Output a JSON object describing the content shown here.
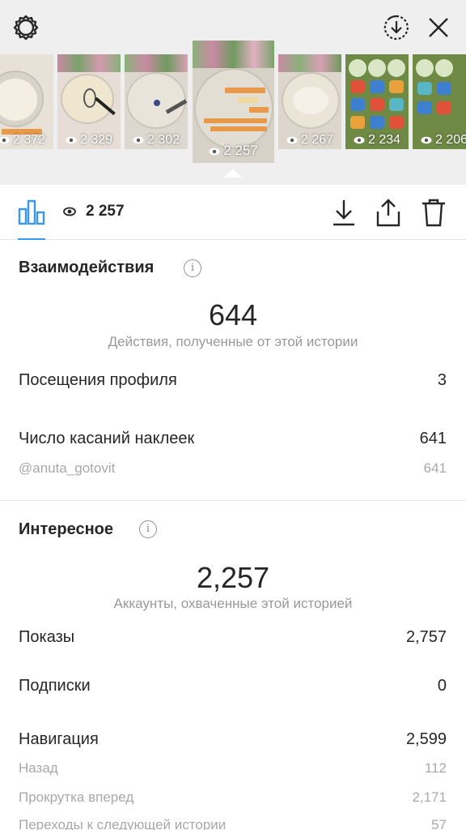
{
  "thumbnails": [
    {
      "views": "2 372"
    },
    {
      "views": "2 329"
    },
    {
      "views": "2 302"
    },
    {
      "views": "2 257"
    },
    {
      "views": "2 267"
    },
    {
      "views": "2 234"
    },
    {
      "views": "2 206"
    }
  ],
  "toolbar": {
    "views": "2 257",
    "icons": [
      "bar-chart-icon",
      "eye-icon",
      "download-icon",
      "share-icon",
      "trash-icon"
    ]
  },
  "top_icons": [
    "gear-icon",
    "download-circle-icon",
    "close-icon"
  ],
  "interactions": {
    "title": "Взаимодействия",
    "total": "644",
    "caption": "Действия, полученные от этой истории",
    "rows": [
      {
        "label": "Посещения профиля",
        "value": "3"
      },
      {
        "label": "Число касаний наклеек",
        "value": "641"
      }
    ],
    "sub_rows": [
      {
        "label": "@anuta_gotovit",
        "value": "641"
      }
    ]
  },
  "discovery": {
    "title": "Интересное",
    "total": "2,257",
    "caption": "Аккаунты, охваченные этой историей",
    "rows": [
      {
        "label": "Показы",
        "value": "2,757"
      },
      {
        "label": "Подписки",
        "value": "0"
      },
      {
        "label": "Навигация",
        "value": "2,599"
      }
    ],
    "sub_rows": [
      {
        "label": "Назад",
        "value": "112"
      },
      {
        "label": "Прокрутка вперед",
        "value": "2,171"
      },
      {
        "label": "Переходы к следующей истории",
        "value": "57"
      }
    ]
  },
  "colors": {
    "accent": "#3897f0",
    "text": "#262626",
    "muted": "#999999",
    "top_background": "#efefef"
  }
}
